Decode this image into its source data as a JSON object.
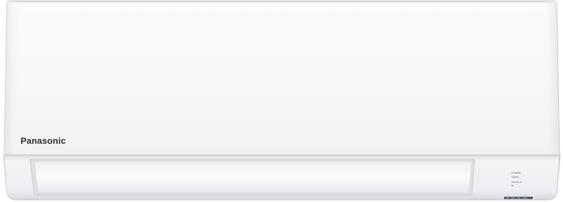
{
  "product": {
    "brand": "Panasonic",
    "indicators": {
      "power": "POWER",
      "timer": "TIMER",
      "nanoe": "nanoe X"
    }
  },
  "colors": {
    "background": "#ffffff",
    "body": "#f7f7f8",
    "logo": "#2a2d33"
  }
}
